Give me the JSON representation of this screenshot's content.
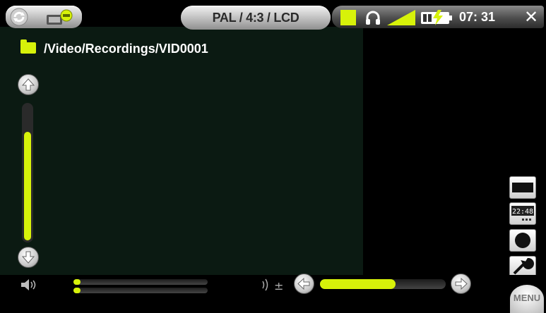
{
  "status_bar": {
    "display_mode": "PAL / 4:3 / LCD",
    "clock": "07: 31"
  },
  "path": {
    "text": "/Video/Recordings/VID0001"
  },
  "volume_slider": {
    "level": 0.8
  },
  "bottom_controls": {
    "audio_track_value": 0.05,
    "adjust_level": 0.6
  },
  "menu": {
    "label": "MENU"
  },
  "colors": {
    "accent": "#d7f20a",
    "background": "#000000"
  },
  "icons": {
    "back": "refresh-icon",
    "camera": "camera-icon",
    "record_indicator": "record-indicator-icon",
    "headphones": "headphones-icon",
    "signal": "signal-icon",
    "battery": "battery-icon",
    "close": "close-icon",
    "folder": "folder-icon",
    "up": "arrow-up-icon",
    "down": "arrow-down-icon",
    "speaker": "speaker-icon",
    "sync": "audio-sync-icon",
    "screen": "screen-mode-icon",
    "timer": "timer-icon",
    "record": "record-button-icon",
    "settings": "wrench-icon"
  }
}
